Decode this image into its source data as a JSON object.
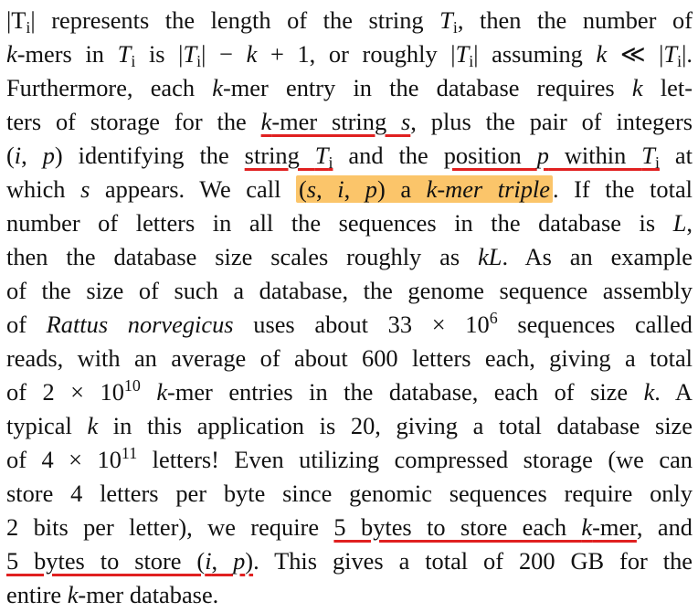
{
  "accent": {
    "underline": "#e02020",
    "highlight": "#fbc56a"
  },
  "lines": [
    [
      {
        "t": "|T"
      },
      {
        "sub": "i"
      },
      {
        "t": "| represents the length of the string "
      },
      {
        "it": "T"
      },
      {
        "sub": "i"
      },
      {
        "t": ", then the number of"
      }
    ],
    [
      {
        "it": "k"
      },
      {
        "t": "-mers in "
      },
      {
        "it": "T"
      },
      {
        "sub": "i"
      },
      {
        "t": " is |"
      },
      {
        "it": "T"
      },
      {
        "sub": "i"
      },
      {
        "t": "| − "
      },
      {
        "it": "k"
      },
      {
        "t": " + 1, or roughly |"
      },
      {
        "it": "T"
      },
      {
        "sub": "i"
      },
      {
        "t": "| assuming "
      },
      {
        "it": "k"
      },
      {
        "t": " ≪ |"
      },
      {
        "it": "T"
      },
      {
        "sub": "i"
      },
      {
        "t": "|."
      }
    ],
    [
      {
        "t": "Furthermore, each "
      },
      {
        "it": "k"
      },
      {
        "t": "-mer entry in the database requires "
      },
      {
        "it": "k"
      },
      {
        "t": " let-"
      }
    ],
    [
      {
        "t": "ters of storage for the "
      },
      {
        "ul": [
          {
            "it": "k"
          },
          {
            "t": "-mer string "
          },
          {
            "it": "s"
          }
        ]
      },
      {
        "t": ", plus the pair of integers"
      }
    ],
    [
      {
        "t": "("
      },
      {
        "it": "i"
      },
      {
        "t": ", "
      },
      {
        "it": "p"
      },
      {
        "t": ") identifying the "
      },
      {
        "ul": [
          {
            "t": "string "
          },
          {
            "it": "T"
          },
          {
            "sub": "i"
          }
        ]
      },
      {
        "t": " and the "
      },
      {
        "ul": [
          {
            "t": "position "
          },
          {
            "it": "p"
          },
          {
            "t": " within "
          },
          {
            "it": "T"
          },
          {
            "sub": "i"
          }
        ]
      },
      {
        "t": " at"
      }
    ],
    [
      {
        "t": "which "
      },
      {
        "it": "s"
      },
      {
        "t": " appears. We call "
      },
      {
        "hl": [
          {
            "t": "("
          },
          {
            "it": "s"
          },
          {
            "t": ", "
          },
          {
            "it": "i"
          },
          {
            "t": ", "
          },
          {
            "it": "p"
          },
          {
            "t": ") a "
          },
          {
            "it": "k-mer triple"
          }
        ]
      },
      {
        "t": ". If the total"
      }
    ],
    [
      {
        "t": "number of letters in all the sequences in the database is "
      },
      {
        "it": "L"
      },
      {
        "t": ","
      }
    ],
    [
      {
        "t": "then the database size scales roughly as "
      },
      {
        "it": "kL"
      },
      {
        "t": ". As an example"
      }
    ],
    [
      {
        "t": "of the size of such a database, the genome sequence assembly"
      }
    ],
    [
      {
        "t": "of "
      },
      {
        "it": "Rattus norvegicus"
      },
      {
        "t": " uses about 33 × 10"
      },
      {
        "sup": "6"
      },
      {
        "t": " sequences called"
      }
    ],
    [
      {
        "t": "reads, with an average of about 600 letters each, giving a total"
      }
    ],
    [
      {
        "t": "of 2 × 10"
      },
      {
        "sup": "10"
      },
      {
        "t": " "
      },
      {
        "it": "k"
      },
      {
        "t": "-mer entries in the database, each of size "
      },
      {
        "it": "k"
      },
      {
        "t": ". A"
      }
    ],
    [
      {
        "t": "typical "
      },
      {
        "it": "k"
      },
      {
        "t": " in this application is 20, giving a total database size"
      }
    ],
    [
      {
        "t": "of 4 × 10"
      },
      {
        "sup": "11"
      },
      {
        "t": " letters! Even utilizing compressed storage (we can"
      }
    ],
    [
      {
        "t": "store 4 letters per byte since genomic sequences require only"
      }
    ],
    [
      {
        "t": "2 bits per letter), we require "
      },
      {
        "ul": [
          {
            "t": "5 bytes to store each "
          },
          {
            "it": "k"
          },
          {
            "t": "-mer"
          }
        ]
      },
      {
        "t": ", and"
      }
    ],
    [
      {
        "ul": [
          {
            "t": "5 bytes to store ("
          },
          {
            "it": "i"
          },
          {
            "t": ", "
          },
          {
            "it": "p"
          },
          {
            "t": ")"
          }
        ]
      },
      {
        "t": ". This gives a total of 200 GB for the"
      }
    ],
    [
      {
        "t": "entire "
      },
      {
        "it": "k"
      },
      {
        "t": "-mer database."
      }
    ]
  ]
}
